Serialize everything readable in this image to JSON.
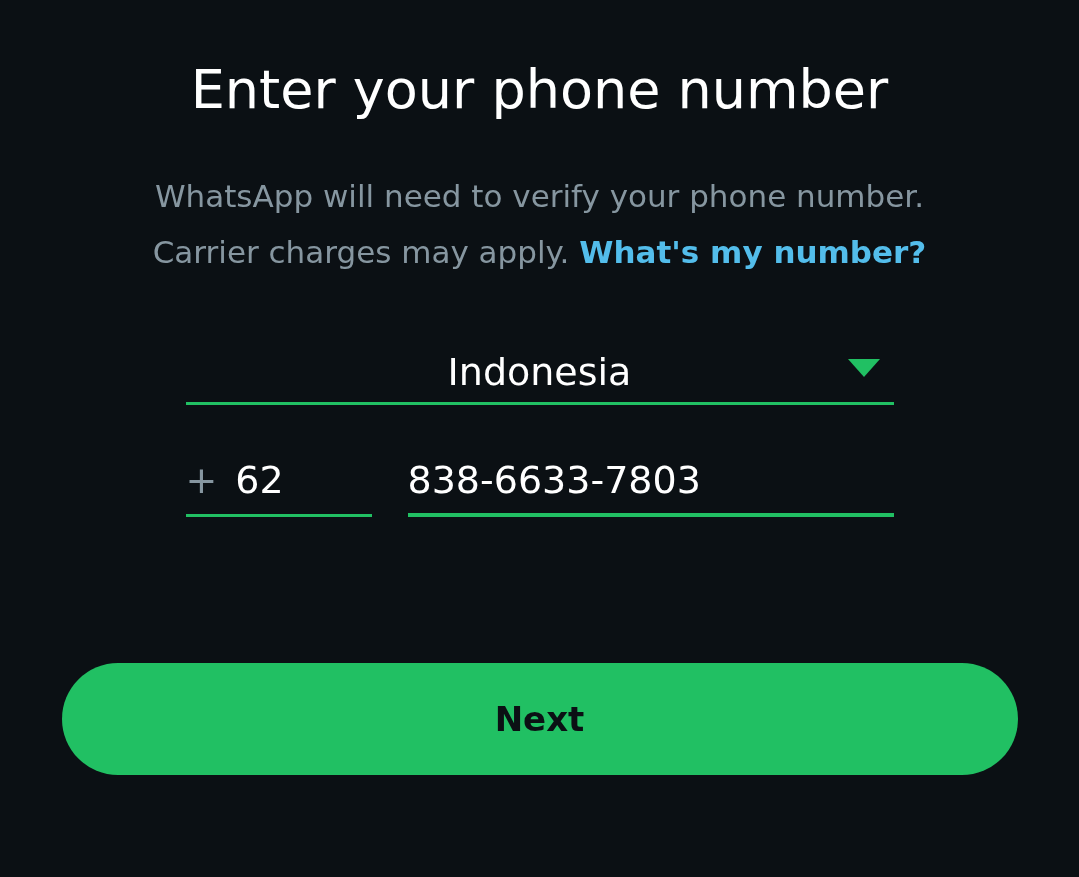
{
  "title": "Enter your phone number",
  "subtitle": {
    "lines": [
      "WhatsApp will need to verify your phone number.",
      "Carrier charges may apply."
    ],
    "link": "What's my number?"
  },
  "country": {
    "value": "Indonesia"
  },
  "phone": {
    "prefix": "+",
    "code": "62",
    "number": "838-6633-7803",
    "code_focused": false,
    "number_focused": true
  },
  "button": {
    "label": "Next"
  }
}
